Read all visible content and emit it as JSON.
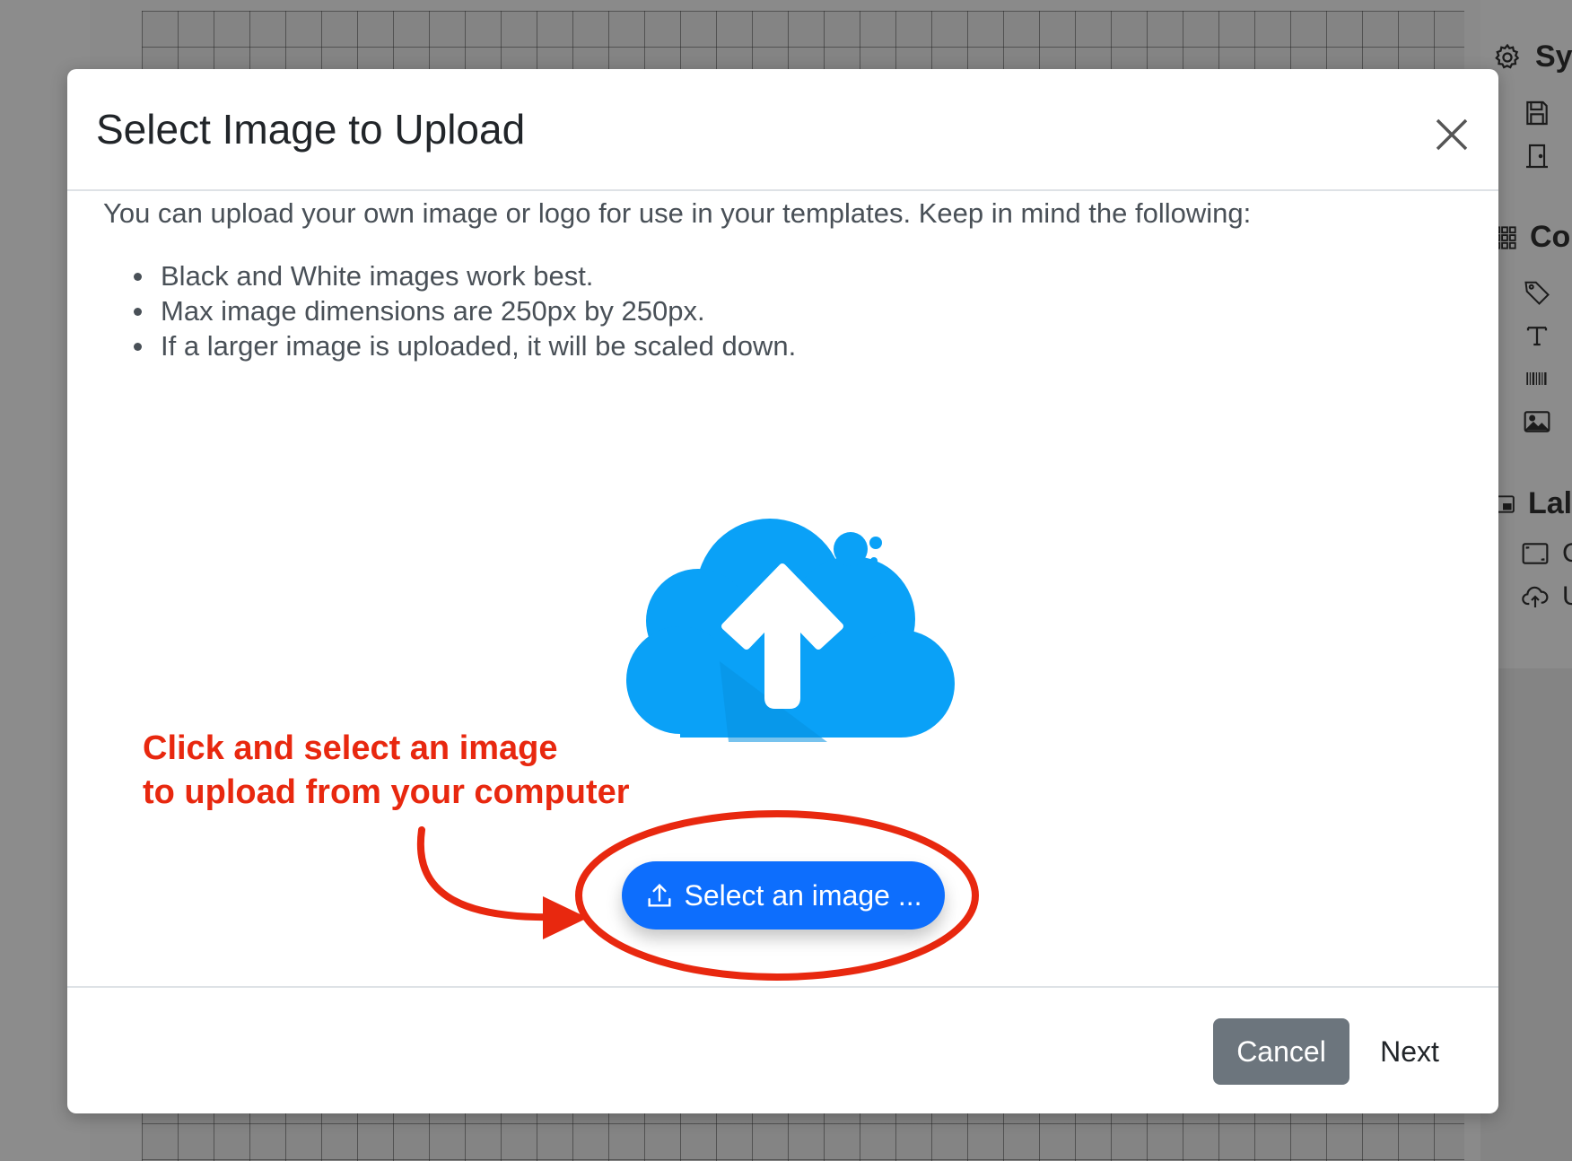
{
  "sidebar": {
    "section_system": "Sy",
    "section_components": "Co",
    "section_label": "Lal",
    "item_c": "C",
    "item_u": "U"
  },
  "modal": {
    "title": "Select Image to Upload",
    "intro": "You can upload your own image or logo for use in your templates. Keep in mind the following:",
    "notes": [
      "Black and White images work best.",
      "Max image dimensions are 250px by 250px.",
      "If a larger image is uploaded, it will be scaled down."
    ],
    "select_button_label": "Select an image ...",
    "cancel_label": "Cancel",
    "next_label": "Next"
  },
  "annotation": {
    "line1": "Click and select an image",
    "line2": "to upload from your computer",
    "color": "#e8280f"
  },
  "colors": {
    "primary": "#0d6efd",
    "secondary": "#6c757d",
    "cloud": "#0aa1f7"
  },
  "icons": {
    "close": "close-icon",
    "upload": "upload-icon",
    "cloud": "cloud-upload-illustration"
  }
}
